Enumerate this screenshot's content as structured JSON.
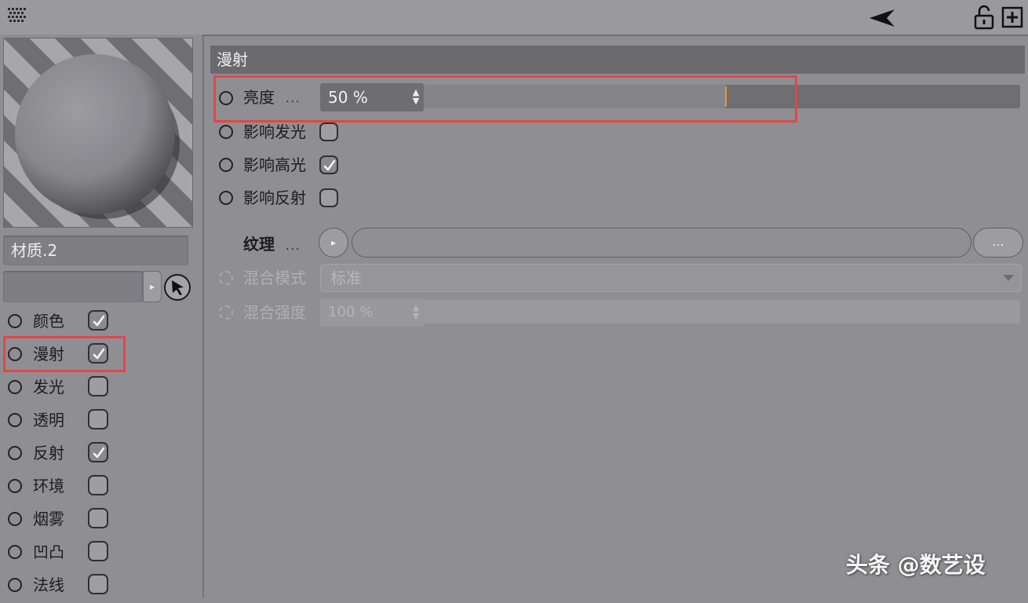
{
  "material": {
    "name": "材质.2"
  },
  "channels": [
    {
      "label": "颜色",
      "checked": true
    },
    {
      "label": "漫射",
      "checked": true
    },
    {
      "label": "发光",
      "checked": false
    },
    {
      "label": "透明",
      "checked": false
    },
    {
      "label": "反射",
      "checked": true
    },
    {
      "label": "环境",
      "checked": false
    },
    {
      "label": "烟雾",
      "checked": false
    },
    {
      "label": "凹凸",
      "checked": false
    },
    {
      "label": "法线",
      "checked": false
    }
  ],
  "section": {
    "title": "漫射"
  },
  "brightness": {
    "label": "亮度",
    "dots": "...",
    "value_text": "50 %",
    "value": 0.5
  },
  "affect_options": [
    {
      "label": "影响发光",
      "checked": false
    },
    {
      "label": "影响高光",
      "checked": true
    },
    {
      "label": "影响反射",
      "checked": false
    }
  ],
  "texture": {
    "label": "纹理",
    "dots": "...",
    "more_label": "..."
  },
  "blend_mode": {
    "label": "混合模式",
    "value": "标准"
  },
  "blend_strength": {
    "label": "混合强度",
    "value_text": "100 %"
  },
  "watermark": "头条 @数艺设",
  "icons": [
    "grip-icon",
    "back-arrow-icon",
    "lock-icon",
    "plus-icon",
    "pick-icon",
    "spin-icon",
    "dropdown-caret-icon"
  ],
  "colors": {
    "highlight": "#e0474a",
    "marker": "#e8a020",
    "background": "#8f8e93"
  }
}
